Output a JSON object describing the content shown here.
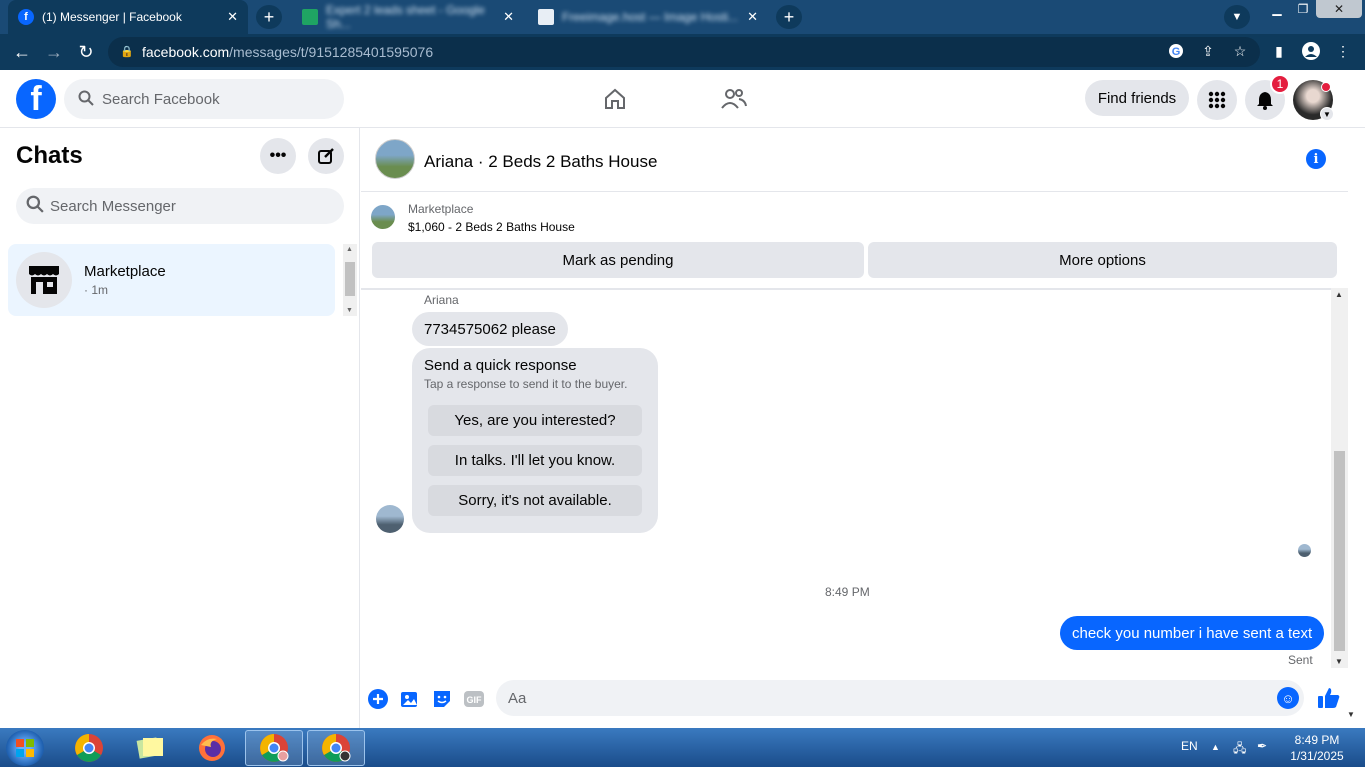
{
  "browser": {
    "active_tab_title": "(1) Messenger | Facebook",
    "tab2_title": "Expert 2 leads sheet - Google Sh...",
    "tab3_title": "Freeimage.host — Image Hosti...",
    "url_host": "facebook.com",
    "url_path": "/messages/t/9151285401595076"
  },
  "fb_header": {
    "search_placeholder": "Search Facebook",
    "find_friends": "Find friends",
    "notification_count": "1"
  },
  "chats": {
    "title": "Chats",
    "search_placeholder": "Search Messenger",
    "items": [
      {
        "name": "Marketplace",
        "time": "· 1m"
      }
    ]
  },
  "conversation": {
    "title": "Ariana · 2 Beds 2 Baths House",
    "marketplace_label": "Marketplace",
    "listing": "$1,060 - 2 Beds 2 Baths House",
    "mark_pending": "Mark as pending",
    "more_options": "More options",
    "sender": "Ariana",
    "incoming_message": "7734575062 please",
    "quick_title": "Send a quick response",
    "quick_subtitle": "Tap a response to send it to the buyer.",
    "quick_responses": [
      "Yes, are you interested?",
      "In talks. I'll let you know.",
      "Sorry, it's not available."
    ],
    "timestamp": "8:49 PM",
    "outgoing_message": "check you number i have sent a text",
    "sent_status": "Sent",
    "composer_placeholder": "Aa"
  },
  "taskbar": {
    "language": "EN",
    "time": "8:49 PM",
    "date": "1/31/2025"
  },
  "colors": {
    "fb_blue": "#0866ff",
    "chrome_frame": "#0e3a5c",
    "bubble_grey": "#e4e6eb",
    "badge_red": "#e41e3f"
  }
}
